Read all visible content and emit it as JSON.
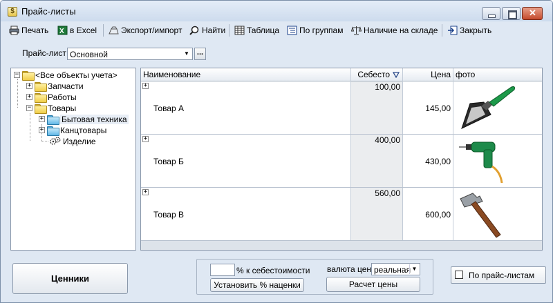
{
  "window": {
    "title": "Прайс-листы"
  },
  "toolbar": {
    "print": "Печать",
    "excel": "в Excel",
    "export_import": "Экспорт/импорт",
    "find": "Найти",
    "table": "Таблица",
    "by_groups": "По группам",
    "in_stock": "Наличие на складе",
    "close": "Закрыть"
  },
  "price_list": {
    "label": "Прайс-лист",
    "value": "Основной",
    "dots": "..."
  },
  "tree": {
    "root": "<Все объекты учета>",
    "items": [
      {
        "label": "Запчасти"
      },
      {
        "label": "Работы"
      },
      {
        "label": "Товары"
      },
      {
        "label": "Бытовая техника"
      },
      {
        "label": "Канцтовары"
      },
      {
        "label": "Изделие"
      }
    ]
  },
  "grid": {
    "columns": {
      "name": "Наименование",
      "cost": "Себесто",
      "price": "Цена",
      "photo": "фото"
    },
    "rows": [
      {
        "name": "Товар А",
        "cost": "100,00",
        "price": "145,00",
        "photo": "trowel"
      },
      {
        "name": "Товар Б",
        "cost": "400,00",
        "price": "430,00",
        "photo": "drill"
      },
      {
        "name": "Товар В",
        "cost": "560,00",
        "price": "600,00",
        "photo": "hammer"
      }
    ]
  },
  "bottom": {
    "tags_button": "Ценники",
    "pct_value": "",
    "pct_label": "% к себестоимости",
    "set_markup_button": "Установить % наценки",
    "currency_label": "валюта цен",
    "currency_value": "реальная",
    "calc_button": "Расчет цены",
    "by_price_lists_label": "По прайс-листам"
  },
  "colors": {
    "accent": "#2a7aa8",
    "grid_bg": "#dde3ea",
    "window_bg": "#dfe8f3"
  }
}
